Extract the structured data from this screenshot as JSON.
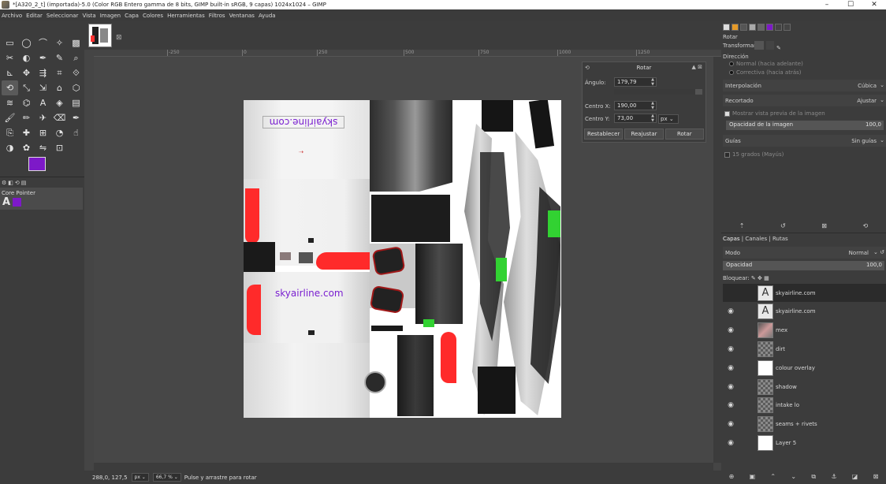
{
  "window": {
    "title": "*[A320_2_t] (importada)-5.0 (Color RGB Entero gamma de 8 bits, GIMP built-in sRGB, 9 capas) 1024x1024 – GIMP",
    "minimize": "–",
    "maximize": "☐",
    "close": "✕"
  },
  "menu": [
    "Archivo",
    "Editar",
    "Seleccionar",
    "Vista",
    "Imagen",
    "Capa",
    "Colores",
    "Herramientas",
    "Filtros",
    "Ventanas",
    "Ayuda"
  ],
  "colors": {
    "foreground": "#7d19c8",
    "background": "#3a3a3a",
    "accent_red": "#ff2a2a",
    "accent_green": "#32d232",
    "text_purple": "#7a1fd0"
  },
  "toolbox": {
    "tools": [
      "rect-select",
      "ellipse-select",
      "free-select",
      "fuzzy-select",
      "by-color-select",
      "scissors",
      "foreground-select",
      "paths",
      "color-picker",
      "zoom",
      "measure",
      "move",
      "align",
      "crop",
      "unified-transform",
      "rotate",
      "scale",
      "shear",
      "perspective",
      "3d-transform",
      "warp",
      "cage",
      "text",
      "bucket-fill",
      "gradient",
      "paintbrush",
      "pencil",
      "airbrush",
      "eraser",
      "ink",
      "clone",
      "heal",
      "perspective-clone",
      "blur",
      "smudge",
      "dodge",
      "mypaint-brush",
      "flip",
      "handle-transform"
    ],
    "device_tab": "Core Pointer",
    "device_letter": "A"
  },
  "rulers": {
    "h_ticks": [
      "-250",
      "0",
      "250",
      "500",
      "750",
      "1000",
      "1250"
    ]
  },
  "canvas": {
    "image_text_flipped": "skyairline.com",
    "image_text": "skyairline.com"
  },
  "rotate_dialog": {
    "title": "Rotar",
    "angle_label": "Ángulo:",
    "angle_value": "179,79",
    "center_x_label": "Centro X:",
    "center_x_value": "190,00",
    "center_y_label": "Centro Y:",
    "center_y_value": "73,00",
    "unit": "px",
    "buttons": [
      "Restablecer",
      "Reajustar",
      "Rotar"
    ]
  },
  "tool_options": {
    "title": "Rotar",
    "transform_label": "Transformar:",
    "direction_label": "Dirección",
    "direction_normal": "Normal (hacia adelante)",
    "direction_corrective": "Correctiva (hacia atrás)",
    "interpolation_label": "Interpolación",
    "interpolation_value": "Cúbica",
    "clipping_label": "Recortado",
    "clipping_value": "Ajustar",
    "preview_label": "Mostrar vista previa de la imagen",
    "opacity_label": "Opacidad de la imagen",
    "opacity_value": "100,0",
    "guides_label": "Guías",
    "guides_value": "Sin guías",
    "degrees_label": "15 grados (Mayús)"
  },
  "layers_panel": {
    "tabs": [
      "Capas",
      "Canales",
      "Rutas"
    ],
    "mode_label": "Modo",
    "mode_value": "Normal",
    "opacity_label": "Opacidad",
    "opacity_value": "100,0",
    "lock_label": "Bloquear:",
    "layers": [
      {
        "name": "skyairline.com",
        "visible": false,
        "type": "text"
      },
      {
        "name": "skyairline.com",
        "visible": true,
        "type": "text"
      },
      {
        "name": "mex",
        "visible": true,
        "type": "image"
      },
      {
        "name": "dirt",
        "visible": true,
        "type": "checker"
      },
      {
        "name": "colour overlay",
        "visible": true,
        "type": "white"
      },
      {
        "name": "shadow",
        "visible": true,
        "type": "checker"
      },
      {
        "name": "intake lo",
        "visible": true,
        "type": "checker"
      },
      {
        "name": "seams + rivets",
        "visible": true,
        "type": "checker"
      },
      {
        "name": "Layer 5",
        "visible": true,
        "type": "white"
      }
    ]
  },
  "status": {
    "coords": "288,0, 127,5",
    "unit": "px",
    "zoom": "66,7 %",
    "message": "Pulse y arrastre para rotar"
  }
}
